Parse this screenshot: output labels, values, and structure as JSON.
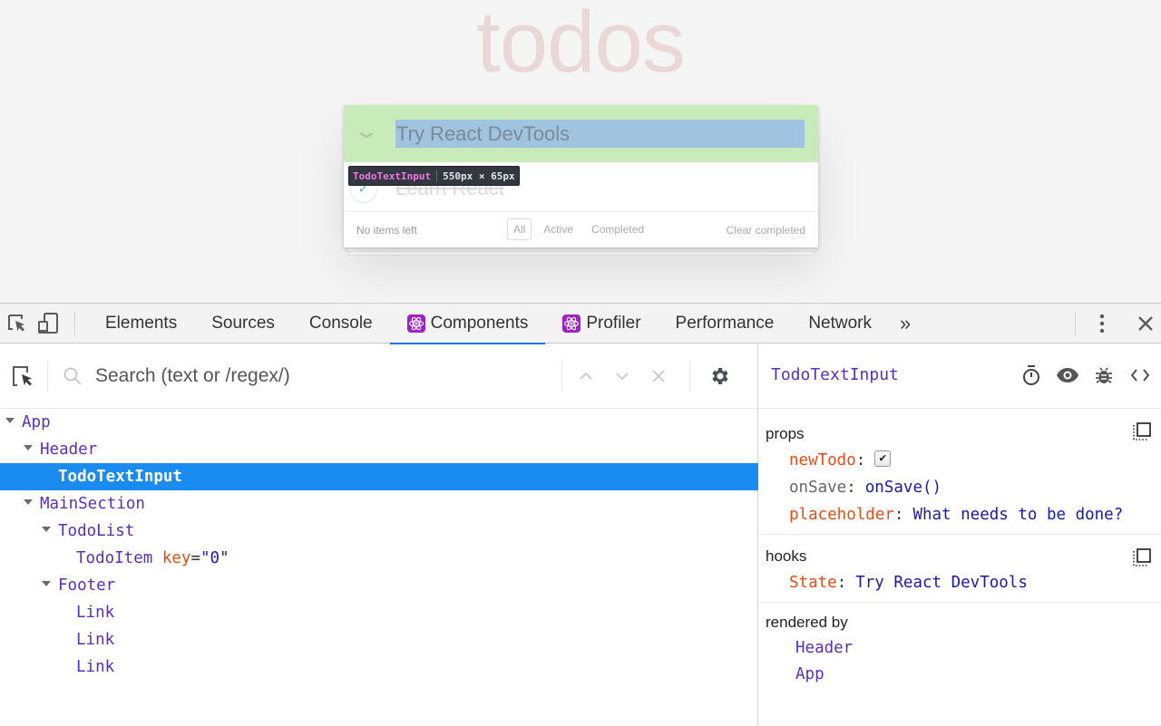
{
  "page": {
    "app_title": "todos",
    "new_todo_value": "Try React DevTools",
    "toggle_all_glyph": "⌄",
    "todos": [
      {
        "label": "Learn React",
        "completed": true
      }
    ],
    "footer": {
      "items_left": "No items left",
      "filters": [
        "All",
        "Active",
        "Completed"
      ],
      "selected_filter": "All",
      "clear_completed": "Clear completed"
    },
    "highlight_tooltip": {
      "component": "TodoTextInput",
      "size": "550px × 65px"
    },
    "colors": {
      "highlight_component": "#c9eab9",
      "highlight_content": "#a0c3df"
    }
  },
  "devtools": {
    "tabs": [
      {
        "label": "Elements",
        "react": false,
        "active": false
      },
      {
        "label": "Sources",
        "react": false,
        "active": false
      },
      {
        "label": "Console",
        "react": false,
        "active": false
      },
      {
        "label": "Components",
        "react": true,
        "active": true
      },
      {
        "label": "Profiler",
        "react": true,
        "active": false
      },
      {
        "label": "Performance",
        "react": false,
        "active": false
      },
      {
        "label": "Network",
        "react": false,
        "active": false
      }
    ],
    "more_tabs_glyph": "»",
    "accent_color": "#1a73e8",
    "search": {
      "placeholder": "Search (text or /regex/)",
      "value": ""
    },
    "tree": [
      {
        "name": "App",
        "depth": 0,
        "expanded": true
      },
      {
        "name": "Header",
        "depth": 1,
        "expanded": true
      },
      {
        "name": "TodoTextInput",
        "depth": 2,
        "selected": true
      },
      {
        "name": "MainSection",
        "depth": 1,
        "expanded": true
      },
      {
        "name": "TodoList",
        "depth": 2,
        "expanded": true
      },
      {
        "name": "TodoItem",
        "depth": 3,
        "key_attr": "key",
        "key_value": "\"0\""
      },
      {
        "name": "Footer",
        "depth": 2,
        "expanded": true
      },
      {
        "name": "Link",
        "depth": 3
      },
      {
        "name": "Link",
        "depth": 3
      },
      {
        "name": "Link",
        "depth": 3
      }
    ],
    "inspector": {
      "title": "TodoTextInput",
      "props_label": "props",
      "props": [
        {
          "key": "newTodo",
          "type": "checkbox",
          "checked": true,
          "value": "✔"
        },
        {
          "key": "onSave",
          "type": "function",
          "value": "onSave()"
        },
        {
          "key": "placeholder",
          "type": "string",
          "value": "What needs to be done?"
        }
      ],
      "hooks_label": "hooks",
      "hooks": [
        {
          "key": "State",
          "value": "Try React DevTools"
        }
      ],
      "rendered_by_label": "rendered by",
      "rendered_by": [
        "Header",
        "App"
      ]
    }
  }
}
